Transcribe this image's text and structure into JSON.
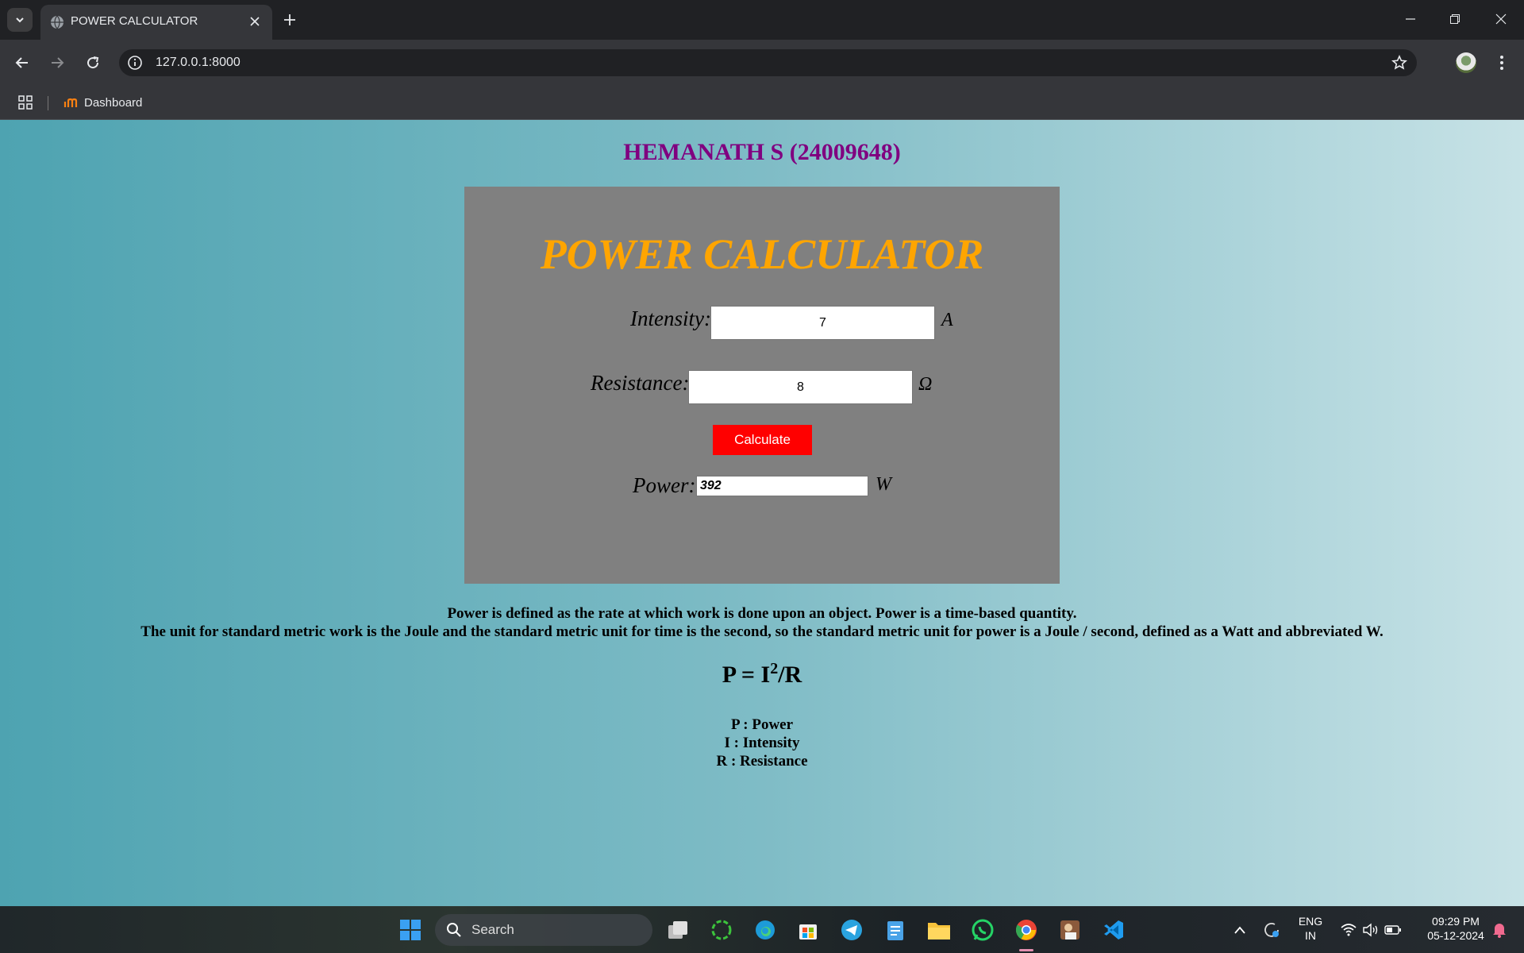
{
  "browser": {
    "tab_title": "POWER CALCULATOR",
    "url": "127.0.0.1:8000",
    "bookmark_label": "Dashboard"
  },
  "page": {
    "student_heading": "HEMANATH S (24009648)",
    "card_title": "POWER CALCULATOR",
    "intensity": {
      "label": "Intensity:",
      "value": "7",
      "unit": "A"
    },
    "resistance": {
      "label": "Resistance:",
      "value": "8",
      "unit": "Ω"
    },
    "calculate_label": "Calculate",
    "power": {
      "label": "Power:",
      "value": "392",
      "unit": "W"
    },
    "description_line1": "Power is defined as the rate at which work is done upon an object. Power is a time-based quantity.",
    "description_line2": "The unit for standard metric work is the Joule and the standard metric unit for time is the second, so the standard metric unit for power is a Joule / second, defined as a Watt and abbreviated W.",
    "formula": {
      "left": "P = I",
      "exponent": "2",
      "right": "/R"
    },
    "legend": [
      "P : Power",
      "I : Intensity",
      "R : Resistance"
    ]
  },
  "taskbar": {
    "search_label": "Search",
    "language": "ENG",
    "region": "IN",
    "time": "09:29 PM",
    "date": "05-12-2024"
  }
}
